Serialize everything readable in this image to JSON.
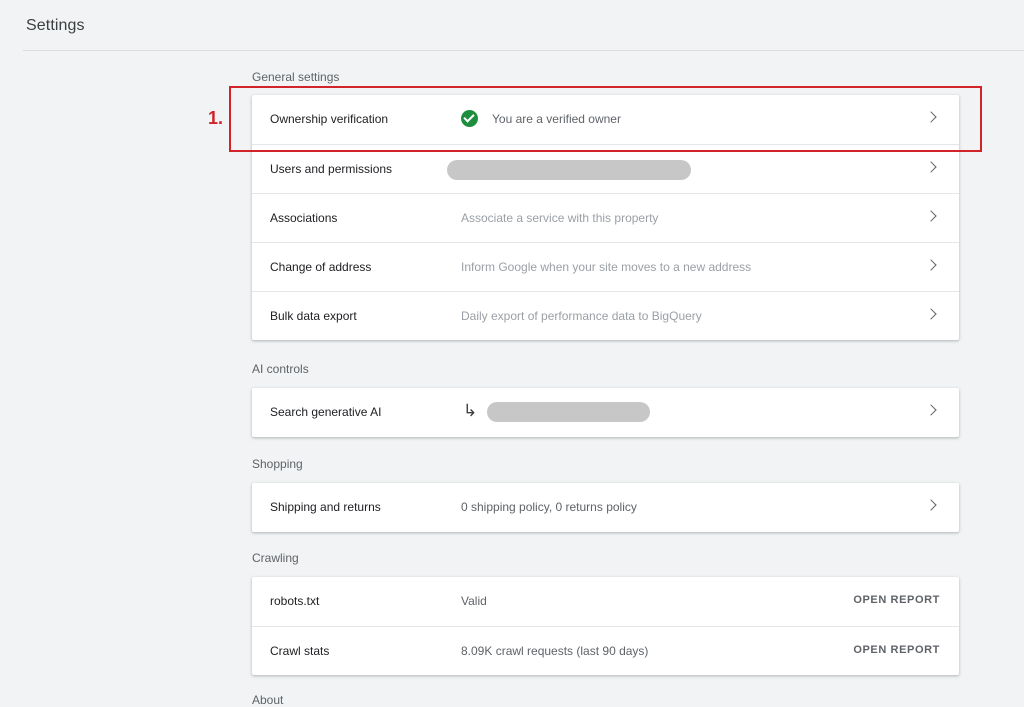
{
  "header": {
    "title": "Settings"
  },
  "general": {
    "title": "General settings",
    "rows": [
      {
        "label": "Ownership verification",
        "status": "You are a verified owner"
      },
      {
        "label": "Users and permissions"
      },
      {
        "label": "Associations",
        "description": "Associate a service with this property"
      },
      {
        "label": "Change of address",
        "description": "Inform Google when your site moves to a new address"
      },
      {
        "label": "Bulk data export",
        "description": "Daily export of performance data to BigQuery"
      }
    ]
  },
  "ai": {
    "title": "AI controls",
    "rows": [
      {
        "label": "Search generative AI"
      }
    ]
  },
  "shopping": {
    "title": "Shopping",
    "rows": [
      {
        "label": "Shipping and returns",
        "description": "0 shipping policy, 0 returns policy"
      }
    ]
  },
  "crawling": {
    "title": "Crawling",
    "rows": [
      {
        "label": "robots.txt",
        "description": "Valid",
        "action": "OPEN REPORT"
      },
      {
        "label": "Crawl stats",
        "description": "8.09K crawl requests (last 90 days)",
        "action": "OPEN REPORT"
      }
    ]
  },
  "about": {
    "title": "About"
  },
  "annotation": {
    "label": "1."
  },
  "icons": {
    "check": "check-circle-icon",
    "chevron": "chevron-right-icon",
    "subdirectory": "subdirectory-arrow-icon"
  },
  "colors": {
    "verified_green": "#1e8e3e",
    "annotation_red": "#d2232a",
    "background": "#f1f3f4"
  }
}
